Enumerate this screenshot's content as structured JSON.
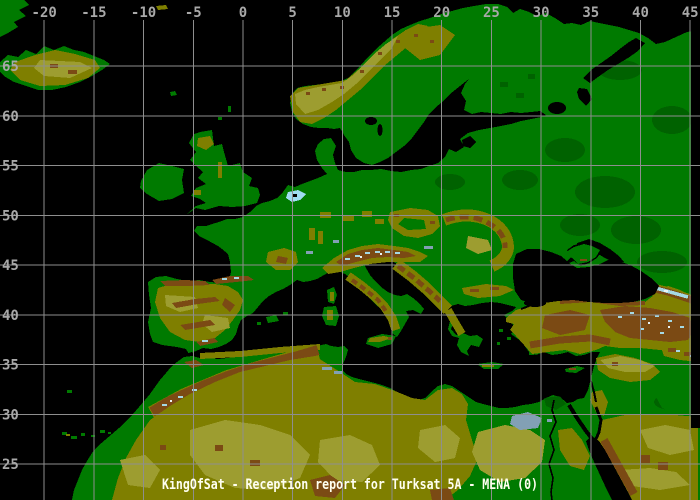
{
  "map": {
    "title": "KingOfSat - Reception report for Turksat 5A - MENA (0)",
    "axes": {
      "top": {
        "values": [
          -20,
          -15,
          -10,
          -5,
          0,
          5,
          10,
          15,
          20,
          25,
          30,
          35,
          40,
          45
        ]
      },
      "left": {
        "values": [
          65,
          60,
          55,
          50,
          45,
          40,
          35,
          30,
          25
        ]
      }
    },
    "palette": {
      "sea": "#000000",
      "lowland_green": "#007a00",
      "dark_green": "#004f00",
      "upland_olive": "#7f7f00",
      "plateau_khaki": "#9d9d30",
      "mountain_brown": "#7b4a14",
      "peak_cyan": "#a5d9e4",
      "peak_white": "#e9f4f4",
      "lake_blue": "#82a0b4",
      "lowland_cyan": "#9fdcf2",
      "grid": "#8e8e8e",
      "axis_label": "#a8a8a8",
      "title_text": "#fffff0"
    }
  }
}
